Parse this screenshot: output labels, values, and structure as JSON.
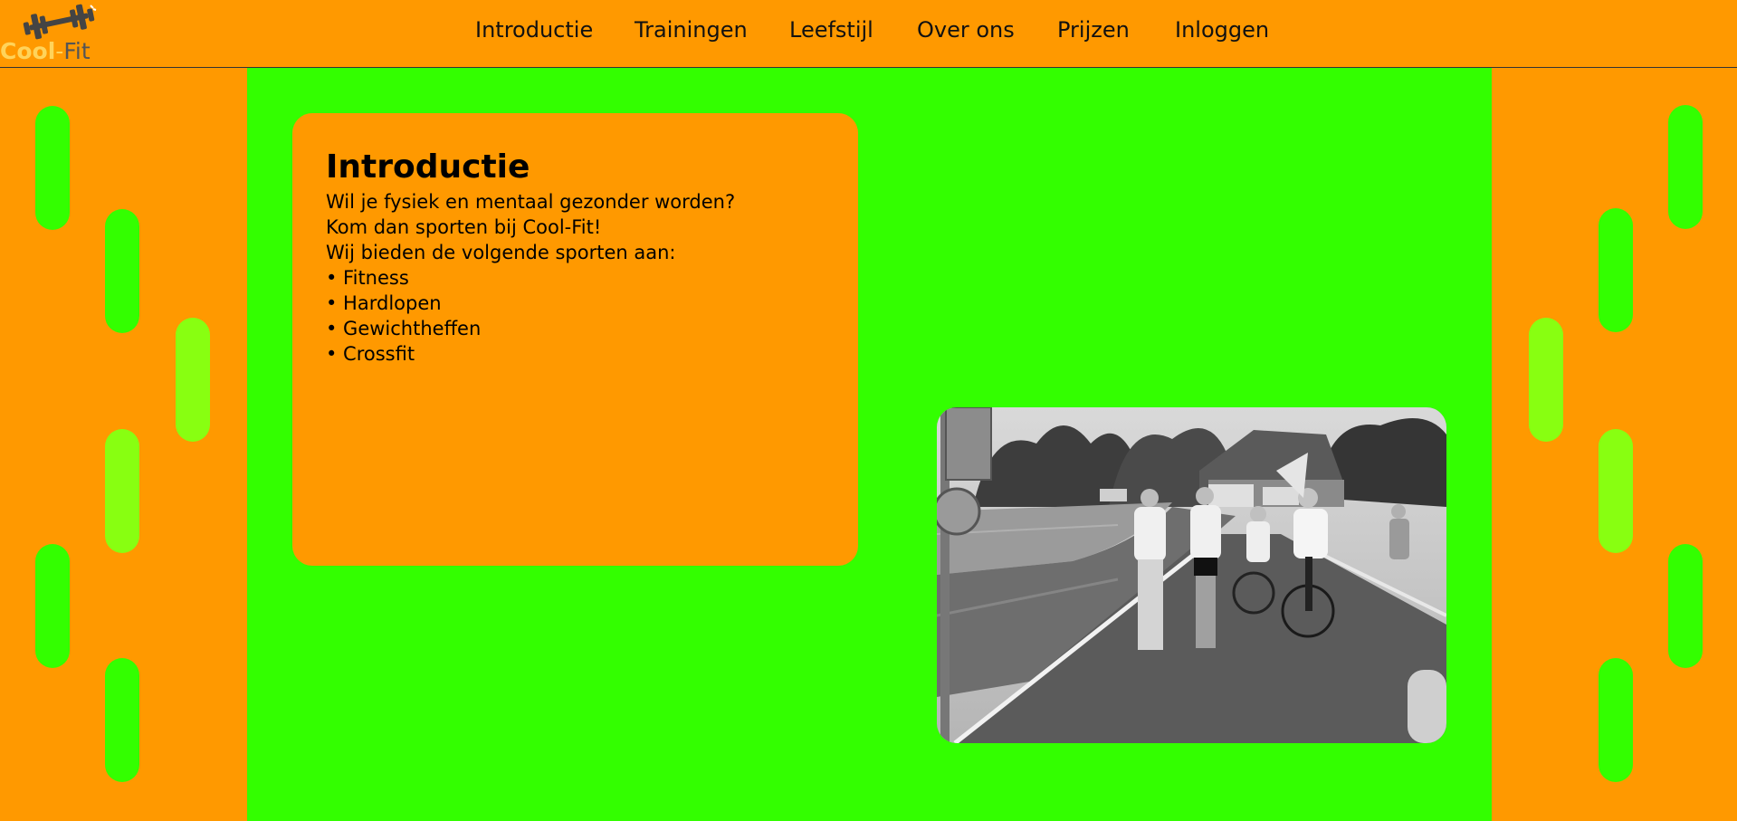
{
  "brand": {
    "logo_cool": "Cool",
    "logo_dash": "-",
    "logo_fit": "Fit"
  },
  "nav": {
    "items": [
      {
        "label": "Introductie"
      },
      {
        "label": "Trainingen"
      },
      {
        "label": "Leefstijl"
      },
      {
        "label": "Over ons"
      },
      {
        "label": "Prijzen"
      },
      {
        "label": "Inloggen"
      }
    ]
  },
  "intro": {
    "title": "Introductie",
    "lines": [
      "Wil je fysiek en mentaal gezonder worden?",
      "Kom dan sporten bij Cool-Fit!",
      "Wij bieden de volgende sporten aan:",
      "• Fitness",
      "• Hardlopen",
      "• Gewichtheffen",
      "• Crossfit"
    ]
  },
  "colors": {
    "page_background": "#ff9900",
    "content_background": "#33ff00",
    "card_background": "#ff9900",
    "pill_green": "#33ff00",
    "pill_light_green": "#88ff11"
  },
  "icons": {
    "logo": "dumbbell-icon"
  }
}
